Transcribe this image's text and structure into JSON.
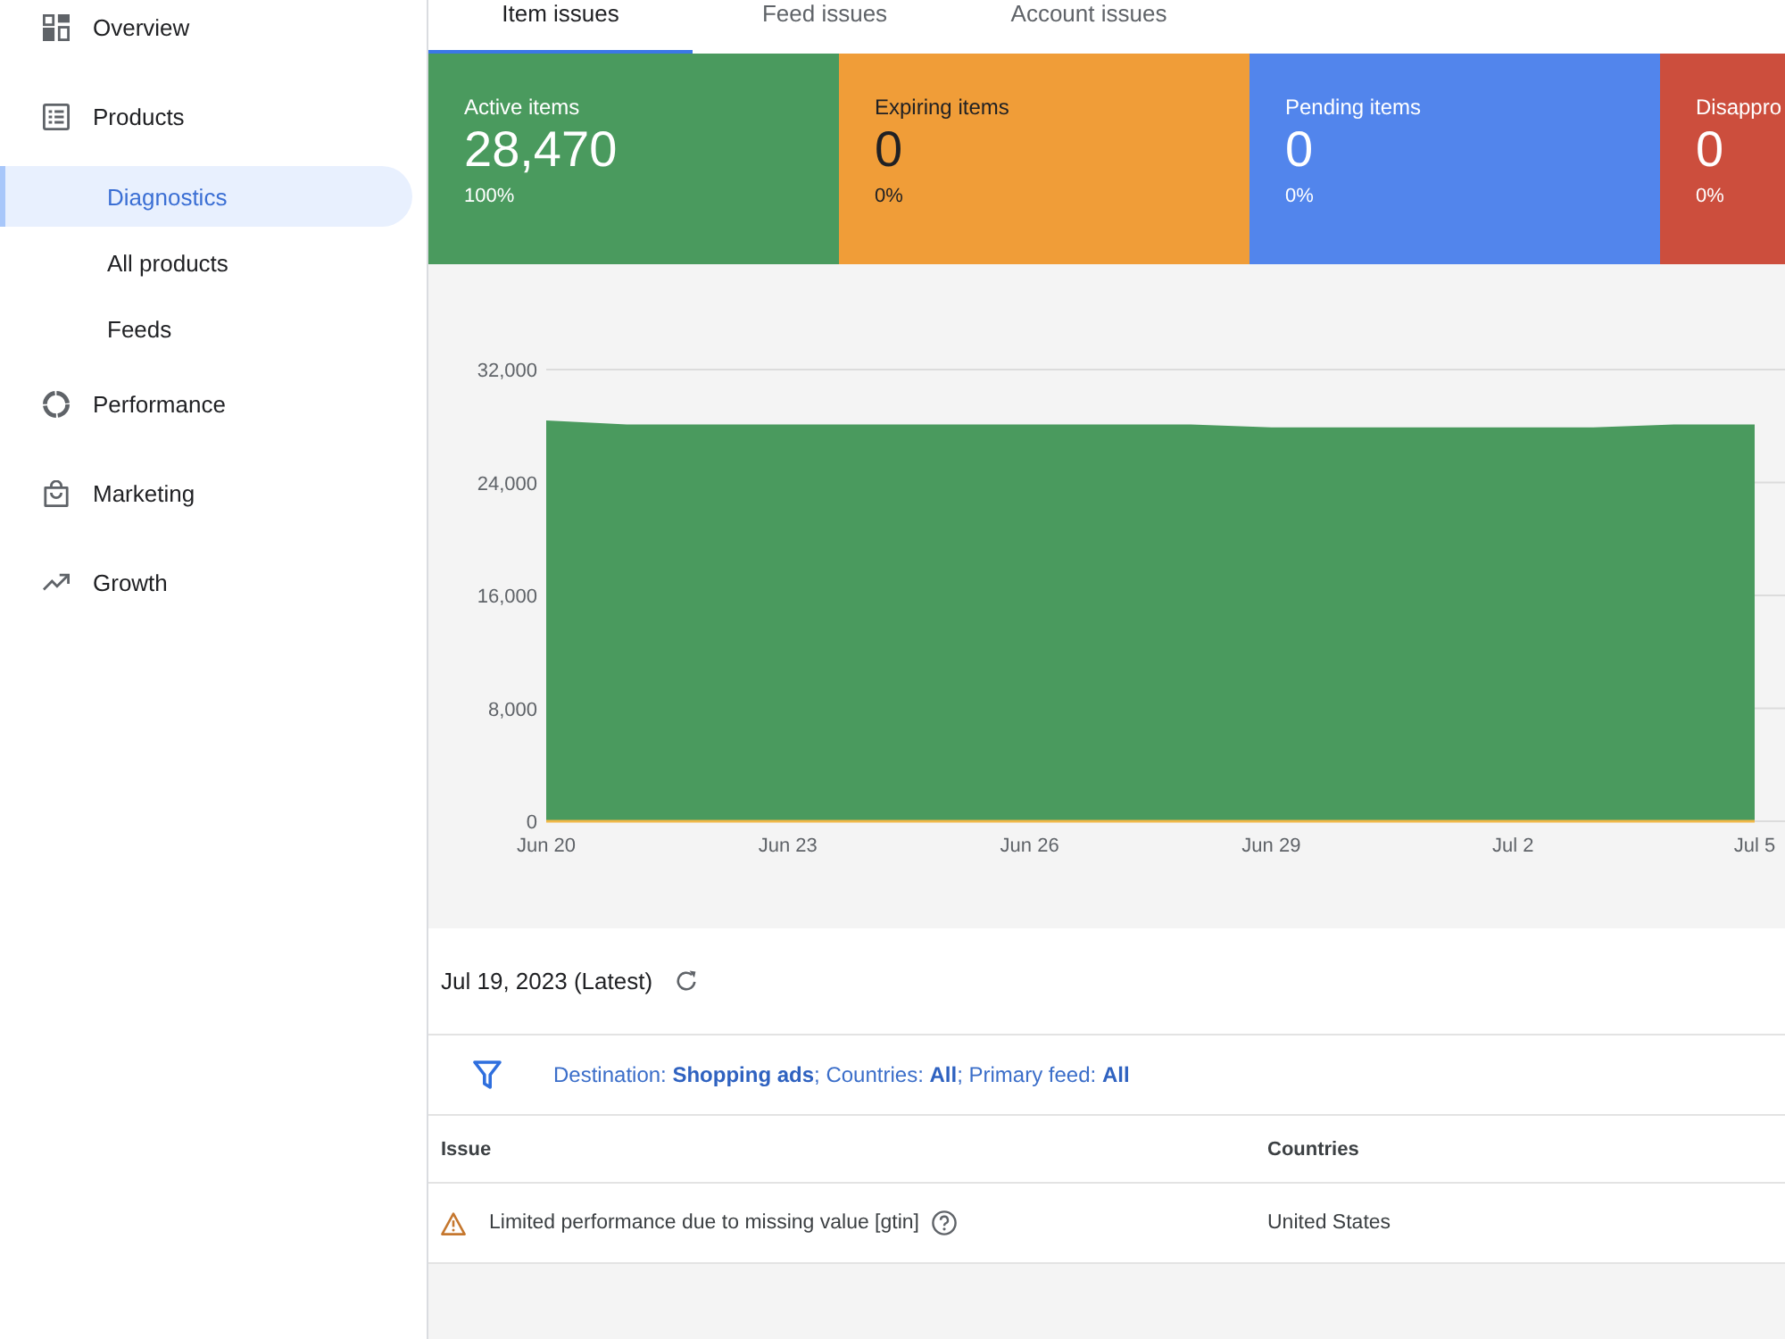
{
  "sidebar": {
    "items": [
      {
        "label": "Overview",
        "selected": false
      },
      {
        "label": "Products",
        "selected": false,
        "children": [
          {
            "label": "Diagnostics",
            "selected": true
          },
          {
            "label": "All products",
            "selected": false
          },
          {
            "label": "Feeds",
            "selected": false
          }
        ]
      },
      {
        "label": "Performance",
        "selected": false
      },
      {
        "label": "Marketing",
        "selected": false
      },
      {
        "label": "Growth",
        "selected": false
      }
    ]
  },
  "tabs": [
    {
      "label": "Item issues",
      "selected": true
    },
    {
      "label": "Feed issues",
      "selected": false
    },
    {
      "label": "Account issues",
      "selected": false
    }
  ],
  "summary_cards": [
    {
      "title": "Active items",
      "value": "28,470",
      "share": "100%",
      "color": "#4a9a5e"
    },
    {
      "title": "Expiring items",
      "value": "0",
      "share": "0%",
      "color": "#f09d38"
    },
    {
      "title": "Pending items",
      "value": "0",
      "share": "0%",
      "color": "#5285ec"
    },
    {
      "title": "Disappro",
      "value": "0",
      "share": "0%",
      "color": "#cc4e3d"
    }
  ],
  "chart": {
    "chart_data": {
      "type": "area",
      "x": [
        "--06-20",
        "--06-21",
        "--06-22",
        "--06-23",
        "--06-24",
        "--06-25",
        "--06-26",
        "--06-27",
        "--06-28",
        "--06-29",
        "--06-30",
        "--07-01",
        "--07-02",
        "--07-03",
        "--07-04",
        "--07-05"
      ],
      "series": [
        {
          "color": "#4a9a5e",
          "values": [
            28400,
            28100,
            28100,
            28100,
            28100,
            28100,
            28100,
            28100,
            28100,
            27900,
            27900,
            27900,
            27900,
            27900,
            28100,
            28100
          ]
        },
        {
          "type": "line",
          "color": "#f0b848",
          "values": [
            0,
            0,
            0,
            0,
            0,
            0,
            0,
            0,
            0,
            0,
            0,
            0,
            0,
            0,
            0,
            0
          ]
        }
      ],
      "xlim": [
        "--06-20",
        "--07-05"
      ],
      "ylim": [
        0,
        32000
      ],
      "yticks": [
        {
          "value": 0,
          "label": "0"
        },
        {
          "value": 8000,
          "label": "8,000"
        },
        {
          "value": 16000,
          "label": "16,000"
        },
        {
          "value": 24000,
          "label": "24,000"
        },
        {
          "value": 32000,
          "label": "32,000"
        }
      ],
      "xticks": [
        {
          "value": "--06-20",
          "label": "Jun 20"
        },
        {
          "value": "--06-23",
          "label": "Jun 23"
        },
        {
          "value": "--06-26",
          "label": "Jun 26"
        },
        {
          "value": "--06-29",
          "label": "Jun 29"
        },
        {
          "value": "--07-02",
          "label": "Jul 2"
        },
        {
          "value": "--07-05",
          "label": "Jul 5"
        }
      ],
      "grid": true
    }
  },
  "snapshot": {
    "date": "Jul 19, 2023 (Latest)"
  },
  "filter": {
    "summary": "Destination: **Shopping ads**; Countries: **All**; Primary feed: **All**"
  },
  "issues_table": {
    "columns": [
      "Issue",
      "Countries"
    ],
    "rows": [
      {
        "issue": "Limited performance due to missing value [gtin]",
        "countries": "United States"
      }
    ]
  }
}
